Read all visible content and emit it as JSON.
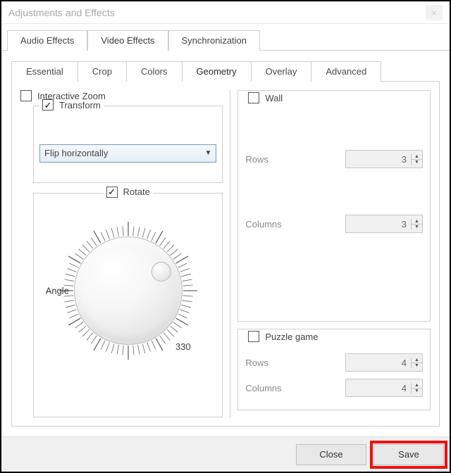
{
  "window": {
    "title": "Adjustments and Effects"
  },
  "tabs": {
    "main": [
      "Audio Effects",
      "Video Effects",
      "Synchronization"
    ],
    "main_active": 1,
    "sub": [
      "Essential",
      "Crop",
      "Colors",
      "Geometry",
      "Overlay",
      "Advanced"
    ],
    "sub_active": 3
  },
  "geometry": {
    "interactive_zoom": {
      "label": "Interactive Zoom",
      "checked": false
    },
    "transform": {
      "label": "Transform",
      "checked": true,
      "value": "Flip horizontally"
    },
    "rotate": {
      "label": "Rotate",
      "checked": true,
      "angle_label": "Angle",
      "angle_value": 330
    },
    "wall": {
      "label": "Wall",
      "checked": false,
      "rows_label": "Rows",
      "rows_value": 3,
      "cols_label": "Columns",
      "cols_value": 3
    },
    "puzzle": {
      "label": "Puzzle game",
      "checked": false,
      "rows_label": "Rows",
      "rows_value": 4,
      "cols_label": "Columns",
      "cols_value": 4
    }
  },
  "footer": {
    "close": "Close",
    "save": "Save"
  }
}
